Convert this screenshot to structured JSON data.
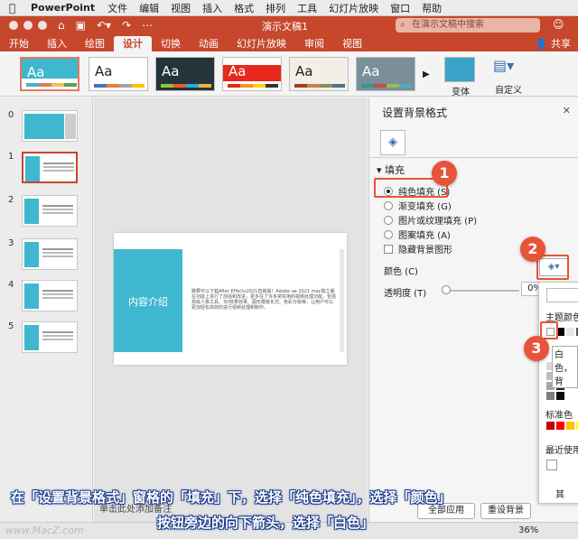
{
  "menubar": {
    "app": "PowerPoint",
    "items": [
      "文件",
      "编辑",
      "视图",
      "插入",
      "格式",
      "排列",
      "工具",
      "幻灯片放映",
      "窗口",
      "帮助"
    ]
  },
  "titlebar": {
    "doc_title": "演示文稿1",
    "search_placeholder": "在演示文稿中搜索"
  },
  "ribbon": {
    "tabs": [
      "开始",
      "插入",
      "绘图",
      "设计",
      "切换",
      "动画",
      "幻灯片放映",
      "审阅",
      "视图"
    ],
    "active_tab": "设计",
    "share": "共享",
    "theme_label": "Aa",
    "variants": "变体",
    "customize": "自定义"
  },
  "slides": {
    "numbers": [
      "0",
      "1",
      "2",
      "3",
      "4",
      "5"
    ],
    "main_title": "内容介绍",
    "main_body": "撒要可以下载After Effects2021直装版！Adobe ae 2021 mac独立版在功能上进行了加强和改进，更多在了许多常实用的视频处理功能，包括高级人像工具、3D效果效果、图形模板化式、色彩分级等，让用户可以更加轻松高效的进行视频处理和制作。"
  },
  "format_pane": {
    "title": "设置背景格式",
    "fill_section": "填充",
    "options": [
      "纯色填充 (S)",
      "渐变填充 (G)",
      "图片或纹理填充 (P)",
      "图案填充 (A)"
    ],
    "hide_bg": "隐藏背景图形",
    "color_label": "颜色 (C)",
    "transparency_label": "透明度 (T)",
    "transparency_value": "0%",
    "popup": {
      "theme_colors": "主题颜色",
      "white_tip": "白色，背",
      "standard": "标准色",
      "recent": "最近使用",
      "other": "其"
    }
  },
  "status": {
    "notes_hint": "单击此处添加备注",
    "apply_all": "全部应用",
    "reset_bg": "重设背景",
    "zoom": "36%",
    "watermark": "www.MacZ.com"
  },
  "callouts": [
    "1",
    "2",
    "3"
  ],
  "caption": {
    "line1": "在「设置背景格式」窗格的「填充」下，选择「纯色填充」，选择「颜色」",
    "line2": "按钮旁边的向下箭头，选择「白色」"
  },
  "colors": {
    "accent": "#c6472c",
    "slide_blue": "#3fb7cf",
    "callout": "#e8533a"
  }
}
